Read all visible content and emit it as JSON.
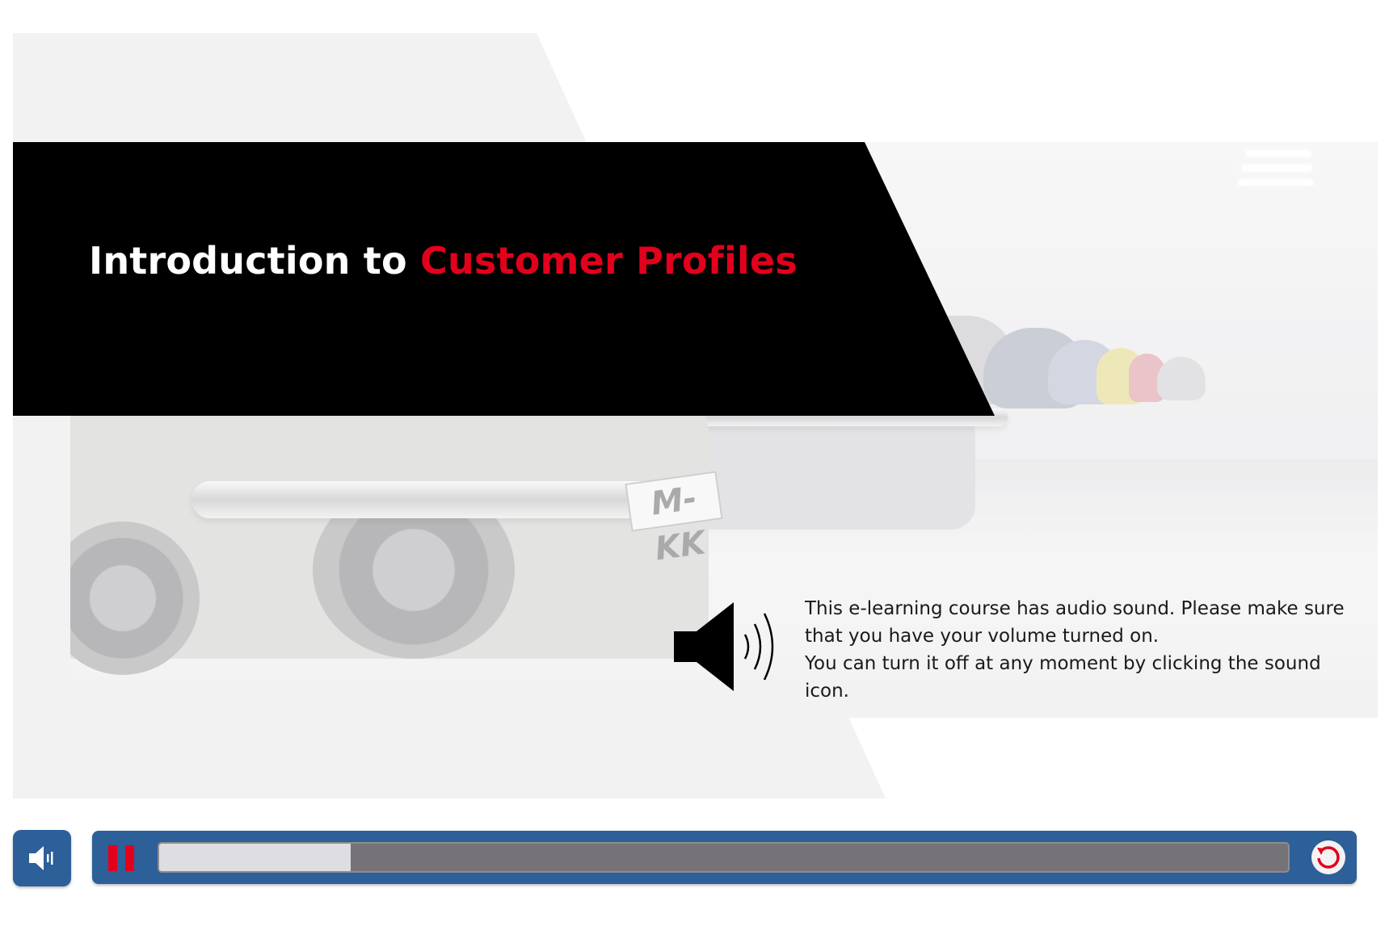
{
  "slide": {
    "title_part1": "Introduction to ",
    "title_part2": "Customer Profiles",
    "notice_line1": "This e-learning course has audio sound. Please make sure that you have your volume turned on.",
    "notice_line2": "You can turn it off at any moment by clicking the sound icon.",
    "license_plate": "M-KK",
    "speaker_icon": "speaker-loud-icon"
  },
  "player": {
    "sound_icon": "volume-icon",
    "pause_icon": "pause-icon",
    "replay_icon": "replay-icon",
    "progress": 0.17
  },
  "colors": {
    "accent_red": "#e3001b",
    "player_blue": "#2d5f99",
    "banner_black": "#000000",
    "track_gray": "#767378",
    "track_fill": "#dedde1"
  }
}
